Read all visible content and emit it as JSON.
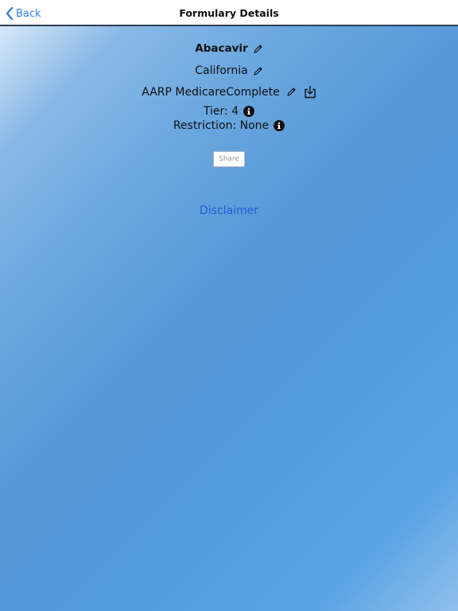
{
  "navbar": {
    "back_label": "Back",
    "title": "Formulary Details"
  },
  "details": {
    "drug_name": "Abacavir",
    "state": "California",
    "plan": "AARP MedicareComplete",
    "tier": "Tier: 4",
    "restriction": "Restriction: None"
  },
  "actions": {
    "share_label": "Share",
    "disclaimer_label": "Disclaimer"
  },
  "icons": {
    "back": "chevron-left-icon",
    "edit": "pencil-icon",
    "download": "download-icon",
    "info": "info-icon"
  },
  "colors": {
    "accent": "#2f7fe6",
    "link": "#1f5fd8",
    "background_mid": "#5497d6"
  }
}
